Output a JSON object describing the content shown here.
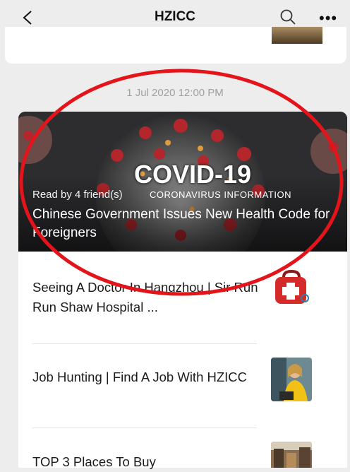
{
  "header": {
    "title": "HZICC",
    "back_icon": "chevron-left-icon",
    "search_icon": "search-icon",
    "more_icon": "more-dots-icon",
    "more_glyph": "•••"
  },
  "timestamp": "1 Jul 2020 12:00 PM",
  "featured": {
    "image_title": "COVID-19",
    "image_subtitle": "CORONAVIRUS INFORMATION",
    "read_by": "Read by 4 friend(s)",
    "headline": "Chinese Government Issues New Health Code for Foreigners"
  },
  "articles": [
    {
      "title": "Seeing A Doctor In Hangzhou | Sir Run Run Shaw Hospital ..."
    },
    {
      "title": "Job Hunting | Find A Job With HZICC"
    },
    {
      "title": "TOP 3 Places To Buy"
    }
  ],
  "annotation": {
    "color": "#e4141b"
  }
}
